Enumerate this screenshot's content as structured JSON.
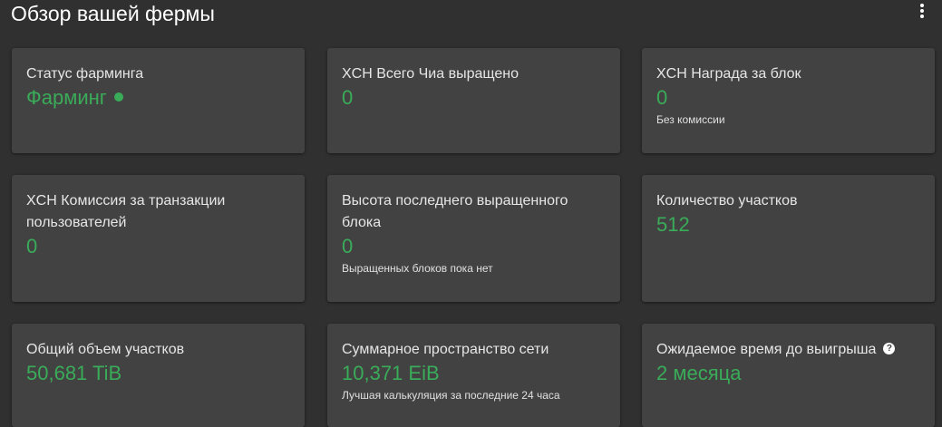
{
  "header": {
    "title": "Обзор вашей фермы",
    "menu_icon": "more-vertical-icon"
  },
  "cards": [
    {
      "title": "Статус фарминга",
      "value": "Фарминг",
      "note": "",
      "status_color": "#3aac59"
    },
    {
      "title": "XCH Всего Чиа выращено",
      "value": "0",
      "note": ""
    },
    {
      "title": "XCH Награда за блок",
      "value": "0",
      "note": "Без комиссии"
    },
    {
      "title": "XCH Комиссия за транзакции пользователей",
      "value": "0",
      "note": ""
    },
    {
      "title": "Высота последнего выращенного блока",
      "value": "0",
      "note": "Выращенных блоков пока нет"
    },
    {
      "title": "Количество участков",
      "value": "512",
      "note": ""
    },
    {
      "title": "Общий объем участков",
      "value": "50,681 TiB",
      "note": ""
    },
    {
      "title": "Суммарное пространство сети",
      "value": "10,371 EiB",
      "note": "Лучшая калькуляция за последние 24 часа"
    },
    {
      "title": "Ожидаемое время до выигрыша",
      "value": "2 месяца",
      "note": "",
      "help_icon": "help-circle-icon",
      "help_glyph": "?"
    }
  ],
  "colors": {
    "background": "#303030",
    "card": "#424242",
    "accent_green": "#3aac59"
  }
}
